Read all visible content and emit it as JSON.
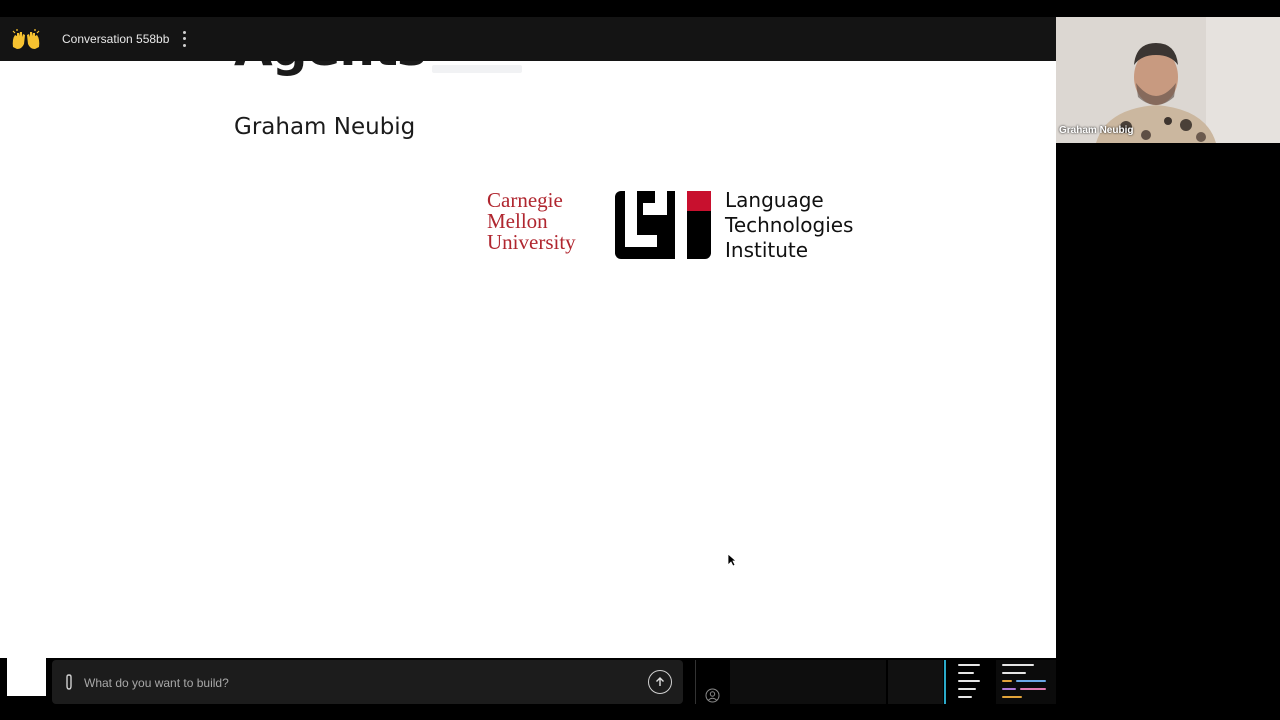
{
  "header": {
    "conversation_title": "Conversation 558bb",
    "logo_icon": "waving-hands-icon",
    "menu_icon": "kebab-menu-icon"
  },
  "slide": {
    "title_fragment": "Agents",
    "author": "Graham Neubig",
    "cmu_line1": "Carnegie",
    "cmu_line2": "Mellon",
    "cmu_line3": "University",
    "lti_line1": "Language",
    "lti_line2": "Technologies",
    "lti_line3": "Institute"
  },
  "video": {
    "participant_name": "Graham Neubig"
  },
  "chat": {
    "placeholder": "What do you want to build?",
    "attach_icon": "paperclip-icon",
    "send_icon": "arrow-up-icon"
  },
  "colors": {
    "cmu_red": "#b0262f",
    "accent_cyan": "#2aa9c9",
    "topbar_bg": "#141414"
  }
}
